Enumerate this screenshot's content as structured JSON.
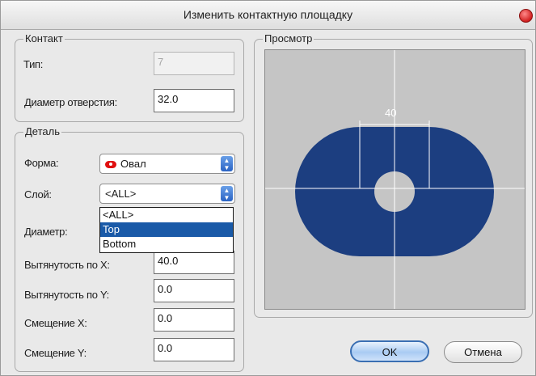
{
  "window": {
    "title": "Изменить контактную площадку"
  },
  "contact_group": {
    "label": "Контакт",
    "type_label": "Тип:",
    "type_value": "7",
    "hole_label": "Диаметр отверстия:",
    "hole_value": "32.0"
  },
  "detail_group": {
    "label": "Деталь",
    "shape_label": "Форма:",
    "shape_value": "Овал",
    "layer_label": "Слой:",
    "layer_value": "<ALL>",
    "layer_options": [
      "<ALL>",
      "Top",
      "Bottom"
    ],
    "layer_selected_option": "Top",
    "diameter_label": "Диаметр:",
    "stretch_x_label": "Вытянутость по X:",
    "stretch_x_value": "40.0",
    "stretch_y_label": "Вытянутость по Y:",
    "stretch_y_value": "0.0",
    "offset_x_label": "Смещение X:",
    "offset_x_value": "0.0",
    "offset_y_label": "Смещение Y:",
    "offset_y_value": "0.0"
  },
  "preview_group": {
    "label": "Просмотр",
    "dimension_label": "40",
    "pad_color": "#1c3e80",
    "background_color": "#c5c5c5"
  },
  "buttons": {
    "ok": "OK",
    "cancel": "Отмена"
  },
  "icons": {
    "close": "close-icon",
    "shape": "oval-shape-icon",
    "select_arrows": "updown-arrows-icon"
  }
}
